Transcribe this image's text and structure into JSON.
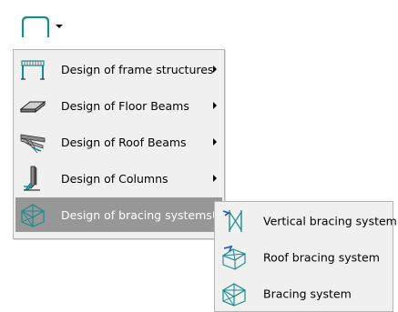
{
  "toolbar": {
    "button_icon": "frame-arch-icon",
    "dropdown_icon": "caret-down-icon",
    "icon_color": "#1a8c8c"
  },
  "menu": {
    "items": [
      {
        "label": "Design of frame structures",
        "icon": "frame-structure-icon",
        "has_submenu": true,
        "active": false
      },
      {
        "label": "Design of Floor Beams",
        "icon": "floor-beam-icon",
        "has_submenu": true,
        "active": false
      },
      {
        "label": "Design of Roof Beams",
        "icon": "roof-beam-icon",
        "has_submenu": true,
        "active": false
      },
      {
        "label": "Design of Columns",
        "icon": "column-icon",
        "has_submenu": true,
        "active": false
      },
      {
        "label": "Design of bracing systems",
        "icon": "bracing-systems-icon",
        "has_submenu": true,
        "active": true
      }
    ],
    "highlight_color": "#979797"
  },
  "submenu": {
    "items": [
      {
        "label": "Vertical bracing system",
        "icon": "vertical-bracing-icon"
      },
      {
        "label": "Roof bracing system",
        "icon": "roof-bracing-icon"
      },
      {
        "label": "Bracing system",
        "icon": "bracing-system-icon"
      }
    ]
  }
}
